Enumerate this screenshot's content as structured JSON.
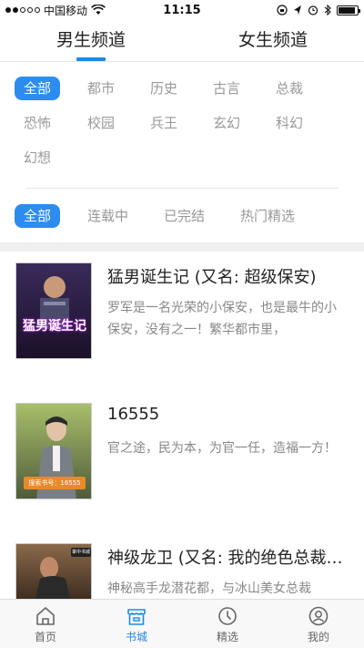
{
  "status_bar": {
    "carrier": "中国移动",
    "time": "11:15",
    "battery_level": 0.9,
    "icons": [
      "signal-icon",
      "wifi-icon",
      "rotation-lock-icon",
      "location-icon",
      "alarm-icon",
      "bluetooth-icon",
      "battery-icon"
    ]
  },
  "top_tabs": [
    {
      "label": "男生频道",
      "active": true
    },
    {
      "label": "女生频道",
      "active": false
    }
  ],
  "filters": {
    "categories": [
      [
        "全部",
        "都市",
        "历史",
        "古言",
        "总裁"
      ],
      [
        "恐怖",
        "校园",
        "兵王",
        "玄幻",
        "科幻"
      ],
      [
        "幻想"
      ]
    ],
    "category_selected": "全部",
    "status": [
      "全部",
      "连载中",
      "已完结",
      "热门精选"
    ],
    "status_selected": "全部"
  },
  "books": [
    {
      "title": "猛男诞生记 (又名: 超级保安)",
      "desc": "罗军是一名光荣的小保安，也是最牛的小保安，没有之一！繁华都市里，",
      "cover_text": "猛男诞生记"
    },
    {
      "title": "16555",
      "desc": "官之途，民为本，为官一任，造福一方！",
      "cover_text": "搜索书号：16555"
    },
    {
      "title": "神级龙卫 (又名: 我的绝色总裁未婚妻)",
      "desc": "神秘高手龙潜花都，与冰山美女总裁",
      "cover_text": "掌中书城"
    }
  ],
  "bottom_nav": [
    {
      "label": "首页",
      "icon": "home-icon",
      "active": false
    },
    {
      "label": "书城",
      "icon": "bookstore-icon",
      "active": true
    },
    {
      "label": "精选",
      "icon": "clock-icon",
      "active": false
    },
    {
      "label": "我的",
      "icon": "profile-icon",
      "active": false
    }
  ],
  "colors": {
    "accent": "#2d8cf0",
    "nav_active": "#1e88e5"
  }
}
